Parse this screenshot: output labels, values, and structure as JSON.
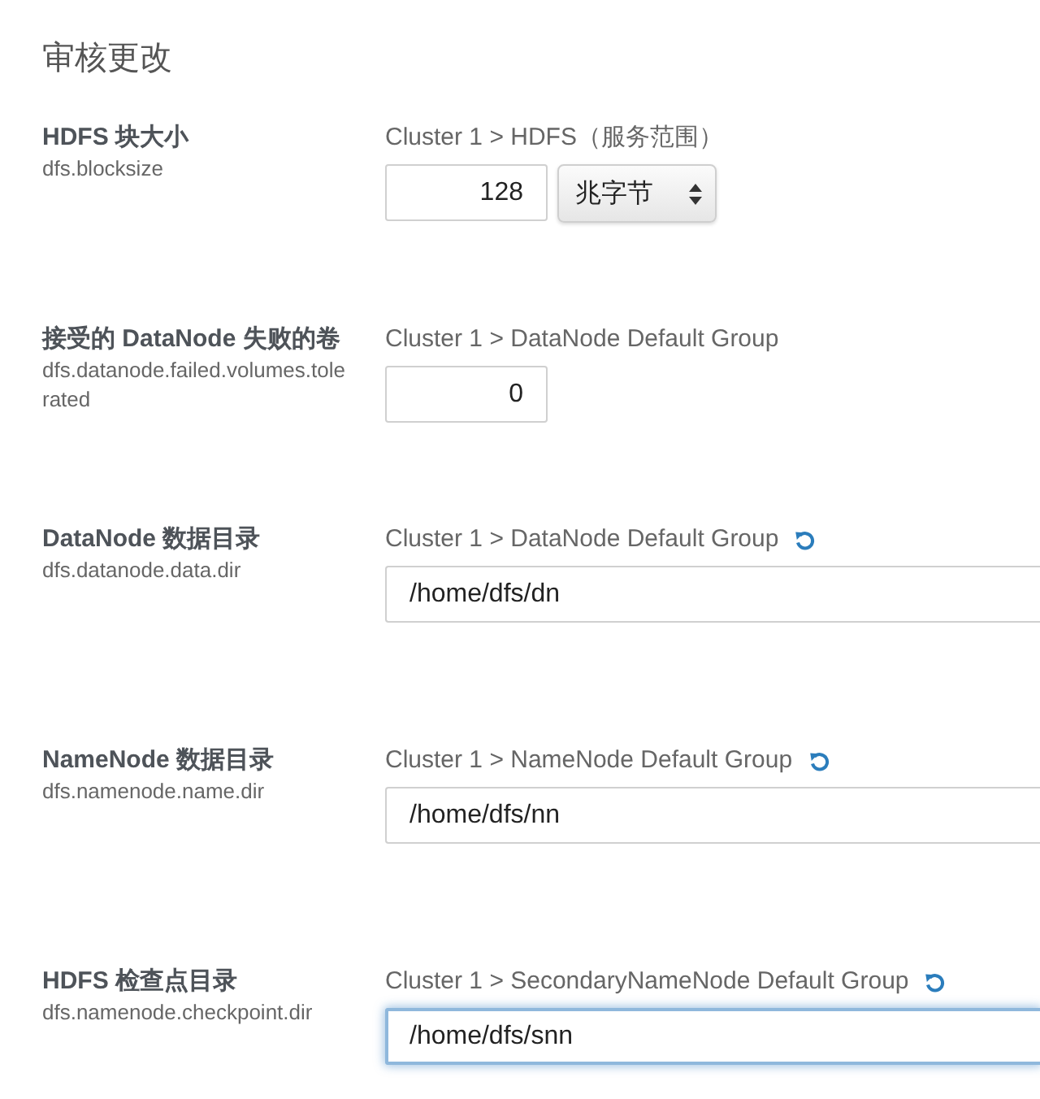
{
  "title": "审核更改",
  "settings": [
    {
      "kind": "number",
      "label": "HDFS 块大小",
      "key": "dfs.blocksize",
      "scope": "Cluster 1 > HDFS（服务范围）",
      "value": "128",
      "unit": "兆字节",
      "modified": false,
      "focused": false
    },
    {
      "kind": "number",
      "label": "接受的 DataNode 失败的卷",
      "key": "dfs.datanode.failed.volumes.tolerated",
      "scope": "Cluster 1 > DataNode Default Group",
      "value": "0",
      "modified": false,
      "focused": false
    },
    {
      "kind": "path",
      "label": "DataNode 数据目录",
      "key": "dfs.datanode.data.dir",
      "scope": "Cluster 1 > DataNode Default Group",
      "value": "/home/dfs/dn",
      "modified": true,
      "focused": false
    },
    {
      "kind": "path",
      "label": "NameNode 数据目录",
      "key": "dfs.namenode.name.dir",
      "scope": "Cluster 1 > NameNode Default Group",
      "value": "/home/dfs/nn",
      "modified": true,
      "focused": false
    },
    {
      "kind": "path",
      "label": "HDFS 检查点目录",
      "key": "dfs.namenode.checkpoint.dir",
      "scope": "Cluster 1 > SecondaryNameNode Default Group",
      "value": "/home/dfs/snn",
      "modified": true,
      "focused": true
    }
  ]
}
